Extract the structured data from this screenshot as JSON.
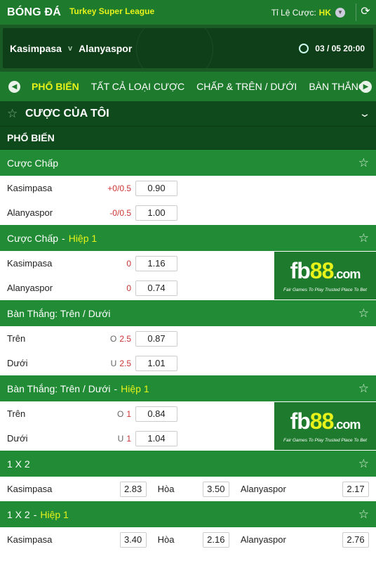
{
  "header": {
    "sport": "BÓNG ĐÁ",
    "league": "Turkey Super League",
    "odds_type_label": "Tỉ Lệ Cược:",
    "odds_type_value": "HK",
    "refresh_icon": "refresh-icon"
  },
  "match": {
    "home": "Kasimpasa",
    "vs": "v",
    "away": "Alanyaspor",
    "datetime": "03 / 05  20:00"
  },
  "tabs": [
    "PHỔ BIẾN",
    "TẤT CẢ LOẠI CƯỢC",
    "CHẤP & TRÊN / DƯỚI",
    "BÀN THẮNG"
  ],
  "my_bets": {
    "title": "CƯỢC CỦA TÔI"
  },
  "section": {
    "title": "PHỔ BIẾN"
  },
  "markets": [
    {
      "title": "Cược Chấp",
      "rows": [
        {
          "name": "Kasimpasa",
          "handicap": "+0/0.5",
          "odds": "0.90"
        },
        {
          "name": "Alanyaspor",
          "handicap": "-0/0.5",
          "odds": "1.00"
        }
      ]
    },
    {
      "title": "Cược Chấp",
      "sep": "-",
      "half": "Hiệp 1",
      "rows": [
        {
          "name": "Kasimpasa",
          "handicap": "0",
          "odds": "1.16"
        },
        {
          "name": "Alanyaspor",
          "handicap": "0",
          "odds": "0.74"
        }
      ]
    },
    {
      "title": "Bàn Thắng: Trên / Dưới",
      "rows": [
        {
          "name": "Trên",
          "ou": "O",
          "handicap": "2.5",
          "odds": "0.87"
        },
        {
          "name": "Dưới",
          "ou": "U",
          "handicap": "2.5",
          "odds": "1.01"
        }
      ]
    },
    {
      "title": "Bàn Thắng: Trên / Dưới",
      "sep": "-",
      "half": "Hiệp 1",
      "rows": [
        {
          "name": "Trên",
          "ou": "O",
          "handicap": "1",
          "odds": "0.84"
        },
        {
          "name": "Dưới",
          "ou": "U",
          "handicap": "1",
          "odds": "1.04"
        }
      ]
    },
    {
      "title": "1 X 2",
      "row": {
        "home": "Kasimpasa",
        "home_odds": "2.83",
        "draw": "Hòa",
        "draw_odds": "3.50",
        "away": "Alanyaspor",
        "away_odds": "2.17"
      }
    },
    {
      "title": "1 X 2",
      "sep": "-",
      "half": "Hiệp 1",
      "row": {
        "home": "Kasimpasa",
        "home_odds": "3.40",
        "draw": "Hòa",
        "draw_odds": "2.16",
        "away": "Alanyaspor",
        "away_odds": "2.76"
      }
    }
  ],
  "ad": {
    "logo_main": "fb",
    "logo_num": "88",
    "logo_dom": ".com",
    "tagline": "Fair Games To Play   Trusted Place To Bet"
  },
  "colors": {
    "primary_green": "#1e7a2c",
    "market_green": "#228b35",
    "dark_green": "#0f4a1c",
    "accent_yellow": "#e6f21a",
    "handicap_red": "#cc3333"
  }
}
